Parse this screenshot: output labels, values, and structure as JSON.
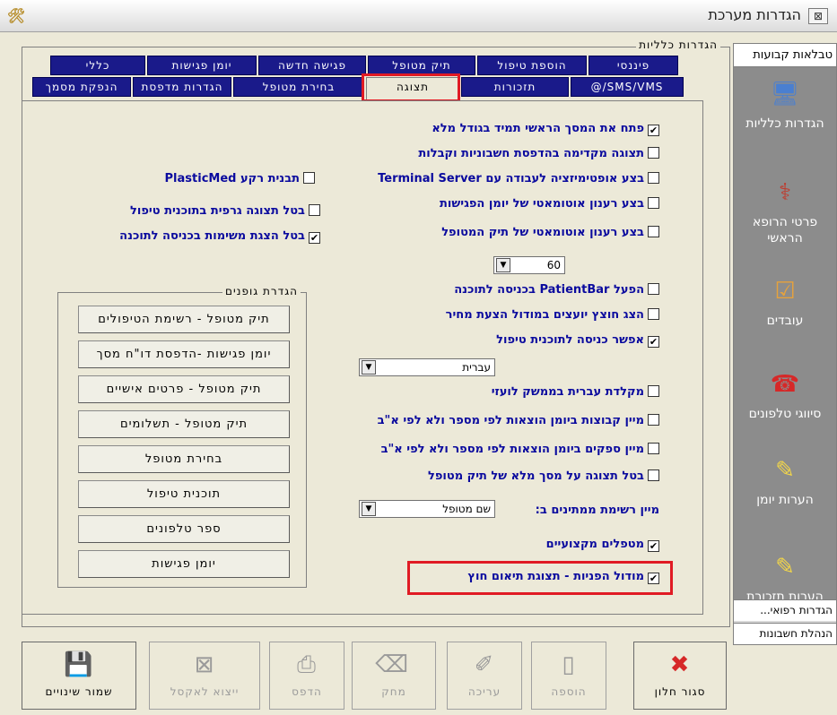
{
  "window": {
    "title": "הגדרות מערכת",
    "close_glyph": "⊠",
    "app_icon": "tools-icon"
  },
  "general_group": {
    "legend": "הגדרות כלליות"
  },
  "tabs_back": [
    {
      "label": "פיננסי"
    },
    {
      "label": "הוספת טיפול"
    },
    {
      "label": "תיק מטופל"
    },
    {
      "label": "פגישה חדשה"
    },
    {
      "label": "יומן פגישות"
    },
    {
      "label": "כללי"
    }
  ],
  "tabs_front": [
    {
      "label": "SMS/VMS/@"
    },
    {
      "label": "תזכורות"
    },
    {
      "label": "תצוגה",
      "active": true
    },
    {
      "label": "בחירת מטופל"
    },
    {
      "label": "הגדרות מדפסת"
    },
    {
      "label": "הנפקת מסמך"
    }
  ],
  "options": {
    "open_fullscreen": {
      "label": "פתח את המסך הראשי תמיד בגודל מלא",
      "checked": true
    },
    "preview_invoices": {
      "label": "תצוגה מקדימה בהדפסת חשבוניות וקבלות",
      "checked": false
    },
    "terminal_server": {
      "label": "בצע אופטימיזציה לעבודה עם Terminal Server",
      "checked": false
    },
    "background_template": {
      "label": "תבנית רקע PlasticMed",
      "checked": false
    },
    "auto_refresh_diary": {
      "label": "בצע רענון אוטומאטי של יומן הפגישות",
      "checked": false
    },
    "disable_graphic_plan": {
      "label": "בטל תצוגה גרפית בתוכנית טיפול",
      "checked": false
    },
    "auto_refresh_patient": {
      "label": "בצע רענון אוטומאטי של תיק המטופל",
      "checked": false
    },
    "disable_tasks_on_entry": {
      "label": "בטל הצגת משימות בכניסה לתוכנה",
      "checked": true
    },
    "enable_patientbar": {
      "label": "הפעל PatientBar בכניסה לתוכנה",
      "checked": false
    },
    "show_advisors_arrow": {
      "label": "הצג חוצץ יועצים במודול הצעת מחיר",
      "checked": false
    },
    "allow_treatment_plan_entry": {
      "label": "אפשר כניסה לתוכנית טיפול",
      "checked": true
    },
    "hebrew_keyboard_foreign": {
      "label": "מקלדת עברית בממשק לועזי",
      "checked": false
    },
    "sort_expense_groups": {
      "label": "מיין קבוצות ביומן הוצאות לפי מספר ולא לפי א\"ב",
      "checked": false
    },
    "sort_suppliers": {
      "label": "מיין ספקים ביומן הוצאות לפי מספר ולא לפי א\"ב",
      "checked": false
    },
    "disable_full_patient_view": {
      "label": "בטל תצוגה על מסך מלא של תיק מטופל",
      "checked": false
    },
    "sort_waiting_list_label": "מיין רשימת ממתינים ב:",
    "professional_therapists": {
      "label": "מטפלים מקצועיים",
      "checked": true
    },
    "referrals_module": {
      "label": "מודול הפניות - תצוגת תיאום חוץ",
      "checked": true
    }
  },
  "refresh_interval": {
    "value": "60"
  },
  "language_select": {
    "value": "עברית"
  },
  "waiting_sort_select": {
    "value": "שם מטופל"
  },
  "printers_group": {
    "legend": "הגדרת גופנים",
    "buttons": [
      {
        "label": "תיק מטופל - רשימת הטיפולים"
      },
      {
        "label": "יומן פגישות -הדפסת דו\"ח מסך"
      },
      {
        "label": "תיק מטופל - פרטים אישיים"
      },
      {
        "label": "תיק מטופל - תשלומים"
      },
      {
        "label": "בחירת מטופל"
      },
      {
        "label": "תוכנית טיפול"
      },
      {
        "label": "ספר טלפונים"
      },
      {
        "label": "יומן פגישות"
      }
    ]
  },
  "sidebar": {
    "header": "טבלאות קבועות",
    "items": [
      {
        "label": "הגדרות כלליות",
        "icon": "computer-icon",
        "color": "#4a7fd0"
      },
      {
        "label": "פרטי הרופא הראשי",
        "icon": "doctor-icon",
        "color": "#c0392b"
      },
      {
        "label": "עובדים",
        "icon": "users-check-icon",
        "color": "#e6a23c"
      },
      {
        "label": "סיווגי טלפונים",
        "icon": "telephone-icon",
        "color": "#d62828"
      },
      {
        "label": "הערות יומן",
        "icon": "notepad-icon",
        "color": "#f1d54a"
      },
      {
        "label": "הערות תזכורת",
        "icon": "notepad-red-icon",
        "color": "#f1d54a"
      }
    ],
    "footers": [
      {
        "label": "הגדרות רפואי..."
      },
      {
        "label": "הנהלת חשבונות"
      }
    ]
  },
  "toolbar": [
    {
      "label": "סגור חלון",
      "icon": "close-window-icon",
      "enabled": true
    },
    {
      "label": "הוספה",
      "icon": "add-page-icon",
      "enabled": false
    },
    {
      "label": "עריכה",
      "icon": "edit-icon",
      "enabled": false
    },
    {
      "label": "מחק",
      "icon": "delete-icon",
      "enabled": false
    },
    {
      "label": "הדפס",
      "icon": "print-icon",
      "enabled": false
    },
    {
      "label": "ייצוא לאקסל",
      "icon": "excel-export-icon",
      "enabled": false
    },
    {
      "label": "שמור שינויים",
      "icon": "save-icon",
      "enabled": true
    }
  ],
  "highlight_color": "#e01b24",
  "tab_color": "#1a1a8a",
  "option_text_color": "#0a0a9e"
}
